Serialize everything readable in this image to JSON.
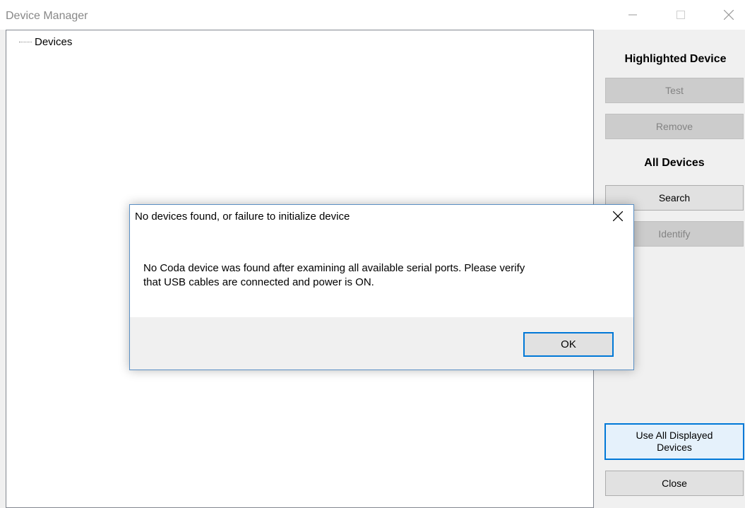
{
  "window": {
    "title": "Device Manager",
    "controls": {
      "minimize": "minimize-icon",
      "maximize": "maximize-icon",
      "close": "close-icon"
    }
  },
  "tree": {
    "root_label": "Devices"
  },
  "sidebar": {
    "highlighted_heading": "Highlighted Device",
    "test_label": "Test",
    "remove_label": "Remove",
    "all_heading": "All Devices",
    "search_label": "Search",
    "identify_label": "Identify",
    "use_all_label": "Use All Displayed Devices",
    "close_label": "Close"
  },
  "dialog": {
    "title": "No devices found, or failure to initialize device",
    "message_line1": "No Coda device was found after examining all available serial ports. Please verify",
    "message_line2": "that USB cables are connected and power is ON.",
    "ok_label": "OK"
  },
  "colors": {
    "accent": "#0078d7",
    "window_bg": "#f0f0f0",
    "disabled_button": "#cccccc"
  }
}
